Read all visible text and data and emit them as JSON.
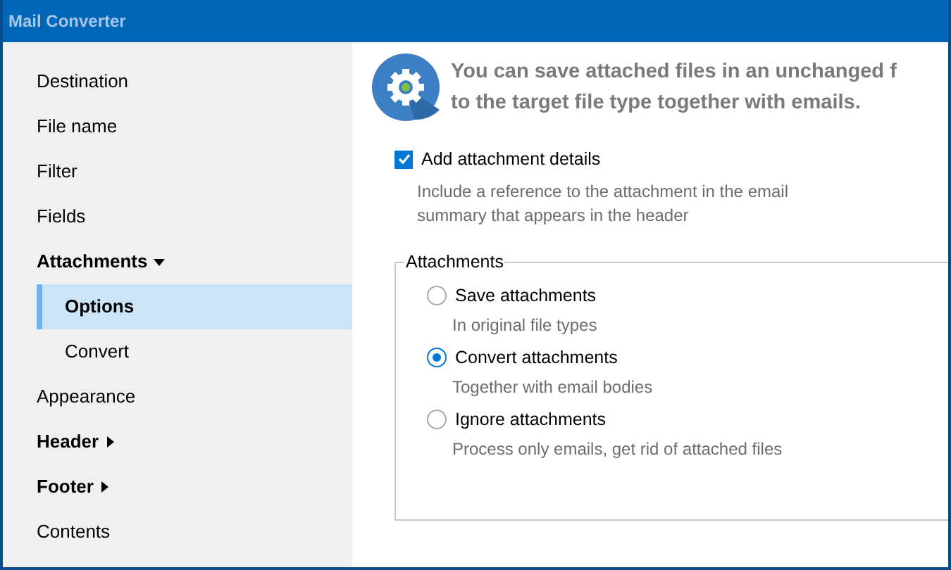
{
  "window": {
    "title": "Mail Converter"
  },
  "sidebar": {
    "items": [
      {
        "label": "Destination",
        "selected": false
      },
      {
        "label": "File name",
        "selected": false
      },
      {
        "label": "Filter",
        "selected": false
      },
      {
        "label": "Fields",
        "selected": false
      },
      {
        "label": "Attachments",
        "selected": false,
        "expanded": true,
        "children": [
          {
            "label": "Options",
            "selected": true
          },
          {
            "label": "Convert",
            "selected": false
          }
        ]
      },
      {
        "label": "Appearance",
        "selected": false
      },
      {
        "label": "Header",
        "selected": false,
        "expanded": false
      },
      {
        "label": "Footer",
        "selected": false,
        "expanded": false
      },
      {
        "label": "Contents",
        "selected": false
      }
    ]
  },
  "header": {
    "lines": [
      "You can save attached files in an unchanged f",
      "to the target file type together with emails."
    ]
  },
  "details_checkbox": {
    "label": "Add attachment details",
    "checked": true,
    "description": "Include a reference to the attachment in the email summary that appears in the header"
  },
  "attachments_group": {
    "title": "Attachments",
    "options": [
      {
        "label": "Save attachments",
        "description": "In original file types",
        "selected": false
      },
      {
        "label": "Convert attachments",
        "description": "Together with email bodies",
        "selected": true
      },
      {
        "label": "Ignore attachments",
        "description": "Process only emails, get rid of attached files",
        "selected": false
      }
    ]
  }
}
